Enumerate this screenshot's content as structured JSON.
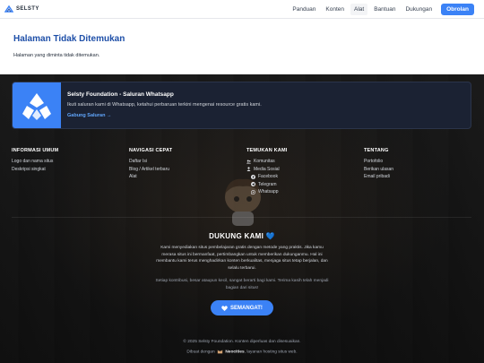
{
  "header": {
    "brand": "SELSTY",
    "nav": [
      {
        "label": "Panduan"
      },
      {
        "label": "Konten"
      },
      {
        "label": "Alat"
      },
      {
        "label": "Bantuan"
      },
      {
        "label": "Dukungan"
      }
    ],
    "cta_label": "Obrolan",
    "active_nav": "Alat"
  },
  "main": {
    "title": "Halaman Tidak Ditemukan",
    "message": "Halaman yang diminta tidak ditemukan."
  },
  "whatsapp_card": {
    "title": "Selsty Foundation - Saluran Whatsapp",
    "description": "Ikuti saluran kami di Whatsapp, ketahui perbaruan terkini mengenai resource gratis kami.",
    "link": "Gabung Saluran →"
  },
  "footer": {
    "columns": [
      {
        "heading": "INFORMASI UMUM",
        "items": [
          "Logo dan nama situs",
          "Deskripsi singkat"
        ]
      },
      {
        "heading": "NAVIGASI CEPAT",
        "items": [
          "Daftar Isi",
          "Blog / Artikel terbaru",
          "Alat"
        ]
      },
      {
        "heading": "TEMUKAN KAMI",
        "items": [
          {
            "label": "Komunitas",
            "icon": "users-icon"
          },
          {
            "label": "Media Sosial",
            "icon": "user-icon"
          },
          {
            "label": "Facebook",
            "icon": "facebook-icon"
          },
          {
            "label": "Telegram",
            "icon": "telegram-icon"
          },
          {
            "label": "Whatsapp",
            "icon": "whatsapp-icon"
          }
        ]
      },
      {
        "heading": "TENTANG",
        "items": [
          "Portofolio",
          "Berikan ulasan",
          "Email pribadi"
        ]
      }
    ],
    "support": {
      "title": "DUKUNG KAMI 💙",
      "text": "Kami menyediakan situs pembelajaran gratis dengan metode yang praktis. Jika kamu merasa situs ini bermanfaat, pertimbangkan untuk memberikan dukunganmu. Hal ini membantu kami terus menghadirkan konten berkualitas, menjaga situs tetap berjalan, dan selalu terbarui.",
      "note": "Setiap kontribusi, besar ataupun kecil, sangat berarti bagi kami. Terima kasih telah menjadi bagian dari situs!",
      "button": "SEMANGAT!"
    },
    "copyright": "© 2025 Selsty Foundation. Konten diperluas dan disesuaikan.",
    "made_prefix": "Dibuat dengan",
    "made_brand": "Neocities",
    "made_suffix": ", layanan hosting situs web."
  },
  "colors": {
    "accent": "#3b82f6",
    "title": "#1e4fa8",
    "card_bg": "#1b2233"
  }
}
